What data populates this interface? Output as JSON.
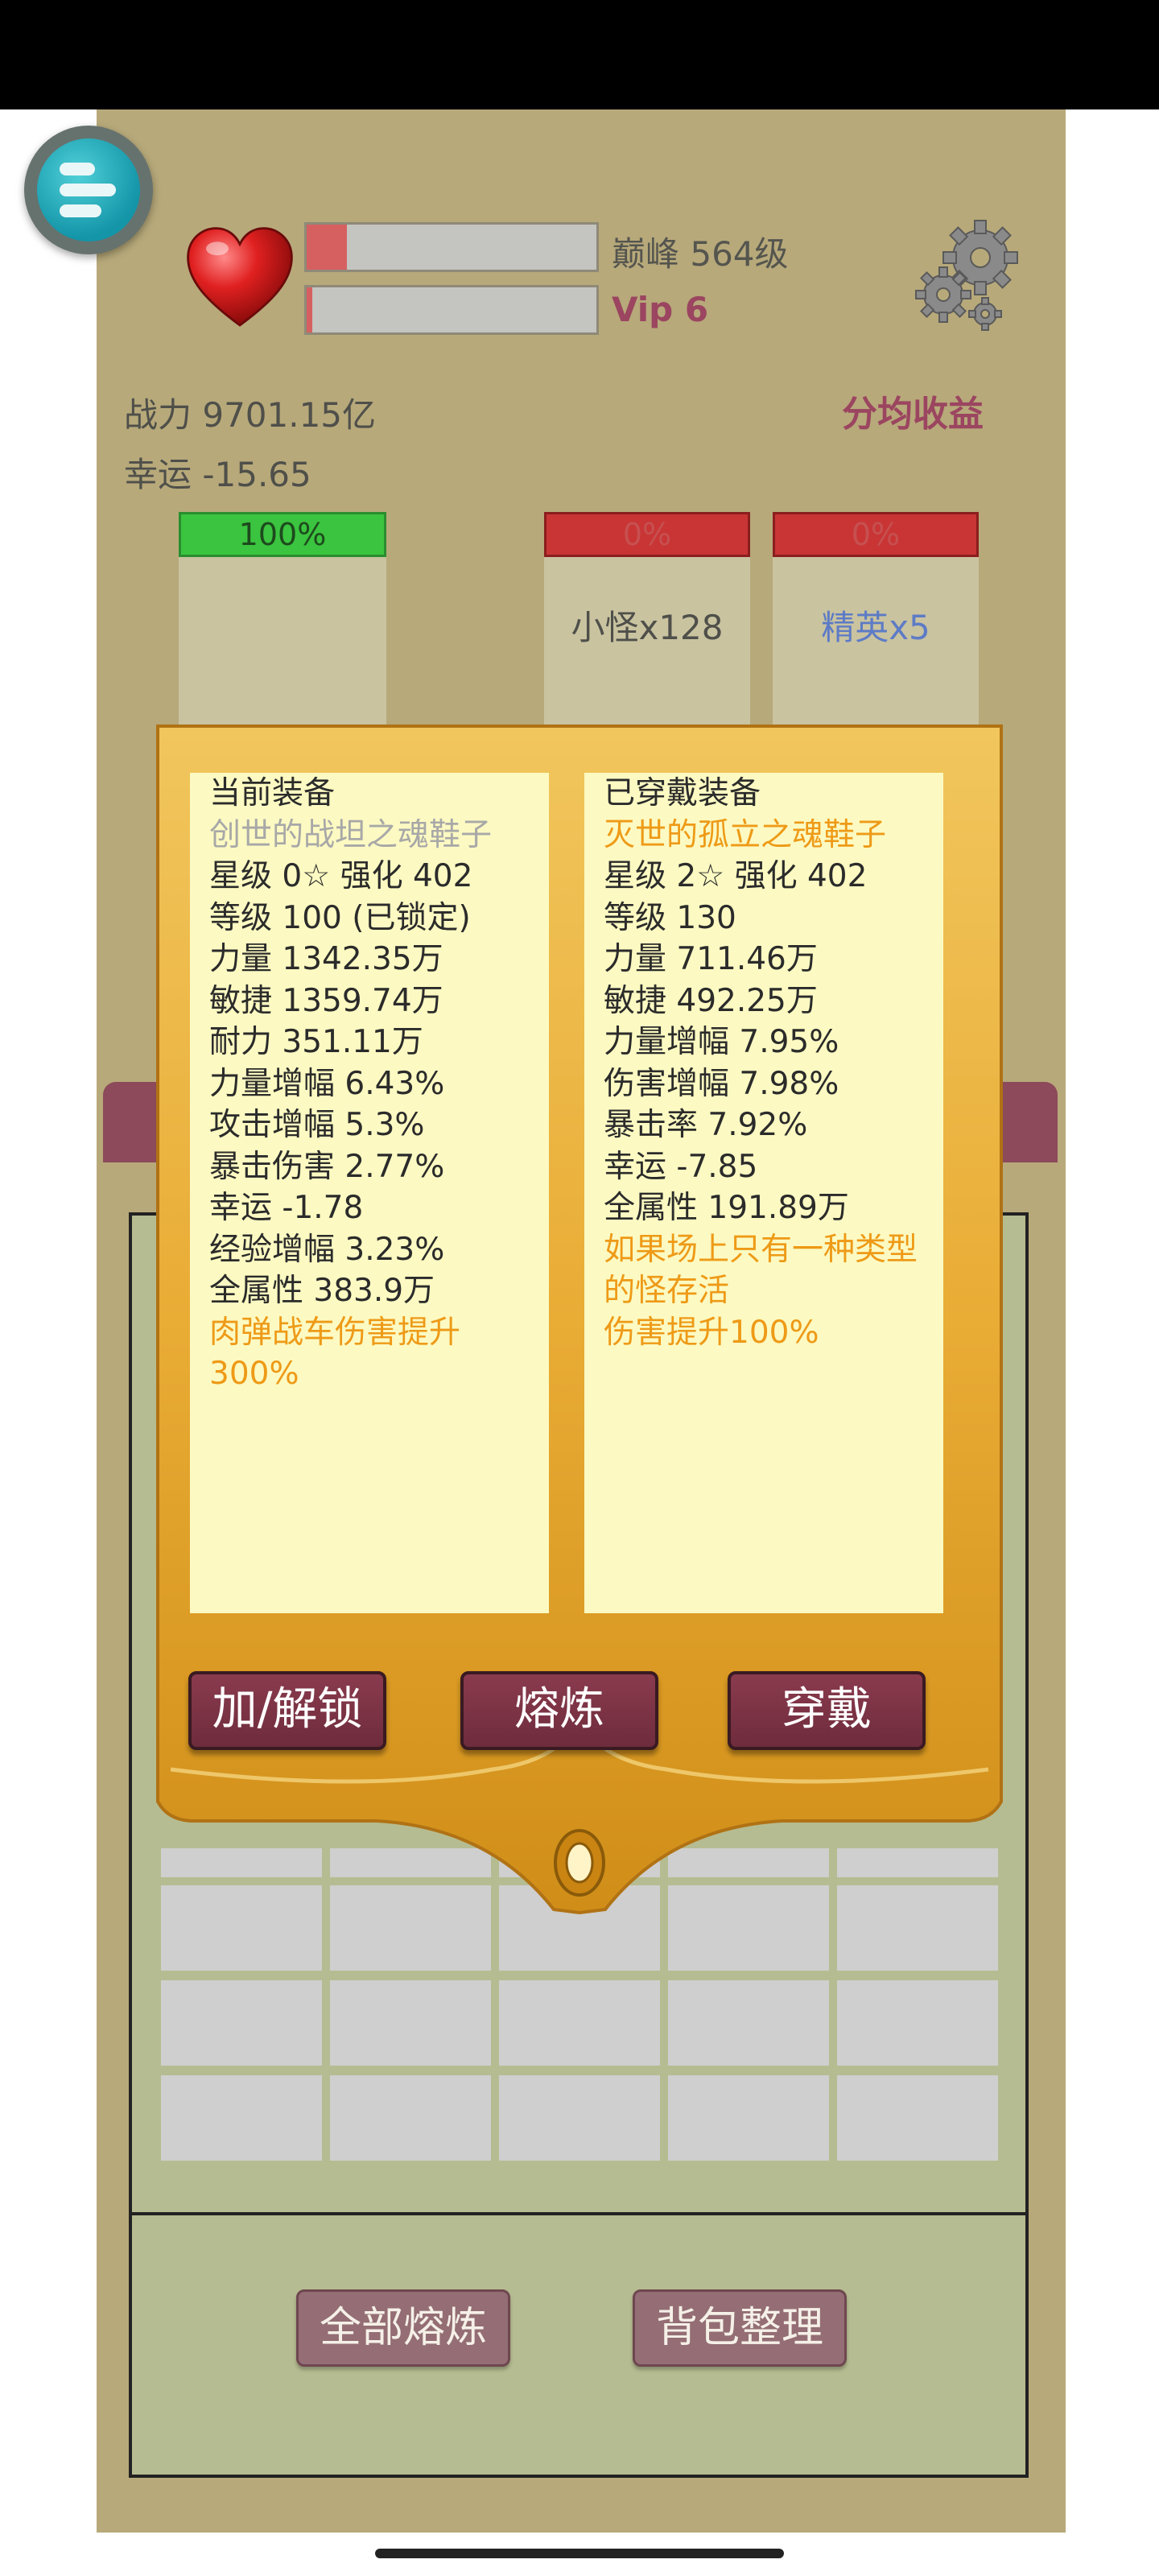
{
  "player": {
    "level_text": "巅峰 564级",
    "vip_text": "Vip 6",
    "hp_fill": 0.14,
    "exp_fill": 0.02,
    "power_text": "战力 9701.15亿",
    "luck_text": "幸运 -15.65",
    "share_link": "分均收益"
  },
  "columns": [
    {
      "percent": "100%",
      "label": ""
    },
    {
      "percent": "0%",
      "label": "小怪x128"
    },
    {
      "percent": "0%",
      "label": "精英x5"
    }
  ],
  "popup": {
    "current": {
      "header": "当前装备",
      "name": "创世的战坦之魂鞋子",
      "lines": [
        "星级 0☆ 强化 402",
        "等级 100 (已锁定)",
        "力量 1342.35万",
        "敏捷 1359.74万",
        "耐力 351.11万",
        "力量增幅 6.43%",
        "攻击增幅 5.3%",
        "暴击伤害 2.77%",
        "幸运 -1.78",
        "经验增幅 3.23%",
        "全属性 383.9万"
      ],
      "special": "肉弹战车伤害提升300%"
    },
    "equipped": {
      "header": "已穿戴装备",
      "name": "灭世的孤立之魂鞋子",
      "lines": [
        "星级 2☆ 强化 402",
        "等级 130",
        "力量 711.46万",
        "敏捷 492.25万",
        "力量增幅 7.95%",
        "伤害增幅 7.98%",
        "暴击率 7.92%",
        "幸运 -7.85",
        "全属性 191.89万"
      ],
      "special": "如果场上只有一种类型的怪存活",
      "special2": "伤害提升100%"
    },
    "buttons": {
      "lock": "加/解锁",
      "smelt": "熔炼",
      "wear": "穿戴"
    }
  },
  "bag": {
    "smelt_all": "全部熔炼",
    "sort": "背包整理"
  },
  "colors": {
    "accent": "#9b4560",
    "panel": "#fcfac2",
    "gold": "#e9a62c",
    "bg": "#b7a97a"
  }
}
